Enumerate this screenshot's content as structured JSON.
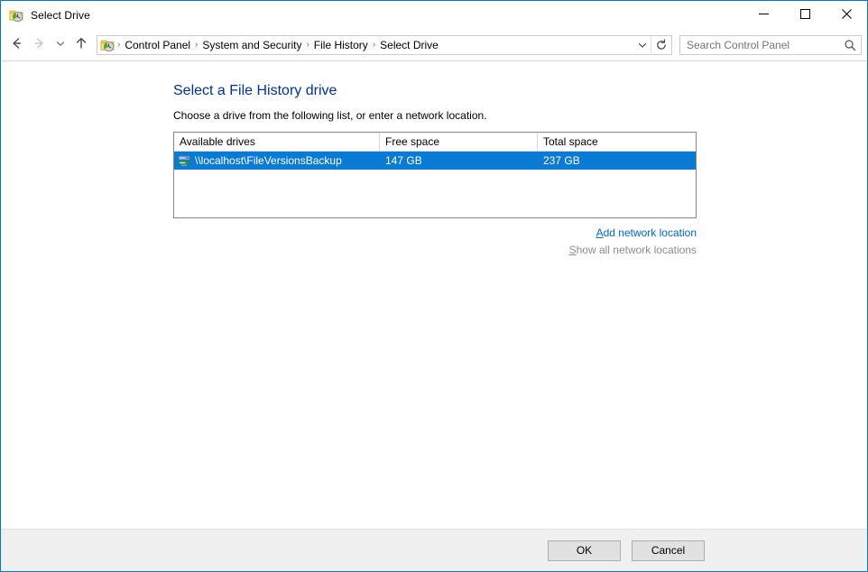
{
  "window": {
    "title": "Select Drive",
    "icon": "file-history-icon",
    "accent_color": "#0078d7",
    "caption": {
      "minimize": "—",
      "maximize": "□",
      "close": "✕"
    }
  },
  "toolbar": {
    "back": "←",
    "forward": "→",
    "recent": "⌄",
    "up": "↑",
    "refresh": "↻",
    "dropdown": "⌄",
    "breadcrumbs": [
      {
        "label": "Control Panel"
      },
      {
        "label": "System and Security"
      },
      {
        "label": "File History"
      },
      {
        "label": "Select Drive"
      }
    ],
    "separator": "›",
    "search": {
      "value": "",
      "placeholder": "Search Control Panel",
      "icon": "search-icon"
    }
  },
  "main": {
    "title": "Select a File History drive",
    "subtitle": "Choose a drive from the following list, or enter a network location.",
    "list": {
      "columns": [
        "Available drives",
        "Free space",
        "Total space"
      ],
      "rows": [
        {
          "icon": "network-drive-icon",
          "name": "\\\\localhost\\FileVersionsBackup",
          "free_space": "147 GB",
          "total_space": "237 GB",
          "selected": true
        }
      ]
    },
    "links": [
      {
        "accesskey": "A",
        "rest": "dd network location",
        "disabled": false
      },
      {
        "accesskey": "S",
        "rest": "how all network locations",
        "disabled": true
      }
    ]
  },
  "footer": {
    "ok_label": "OK",
    "cancel_label": "Cancel"
  }
}
